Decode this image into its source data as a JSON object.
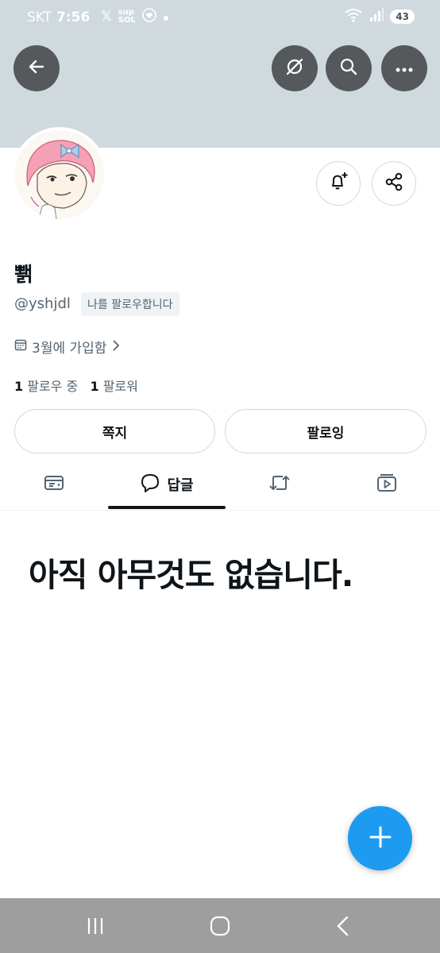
{
  "status_bar": {
    "carrier": "SKT",
    "time": "7:56",
    "icons": [
      "x-logo-icon",
      "super-sol-icon",
      "heart-circle-icon",
      "dot-icon"
    ],
    "right_icons": [
      "wifi-icon",
      "signal-icon"
    ],
    "battery": "43"
  },
  "header": {
    "buttons": [
      "back-icon",
      "grok-icon",
      "search-icon",
      "more-icon"
    ],
    "banner_color": "#cfd9de"
  },
  "profile": {
    "display_name": "뾁",
    "handle": "@yshjdl",
    "follows_you_badge": "나를 팔로우합니다",
    "joined": "3월에 가입함",
    "following_count": "1",
    "following_label": "팔로우 중",
    "followers_count": "1",
    "followers_label": "팔로워"
  },
  "actions": {
    "message_label": "쪽지",
    "following_button_label": "팔로잉"
  },
  "tabs": [
    {
      "name": "posts",
      "icon": "post-card-icon",
      "label": ""
    },
    {
      "name": "replies",
      "icon": "speech-bubble-icon",
      "label": "답글",
      "active": true
    },
    {
      "name": "reposts",
      "icon": "repost-icon",
      "label": ""
    },
    {
      "name": "media",
      "icon": "media-play-icon",
      "label": ""
    }
  ],
  "empty_state": {
    "title": "아직 아무것도 없습니다."
  },
  "colors": {
    "accent": "#1d9bf0",
    "text": "#0f1419",
    "secondary_text": "#536471"
  }
}
